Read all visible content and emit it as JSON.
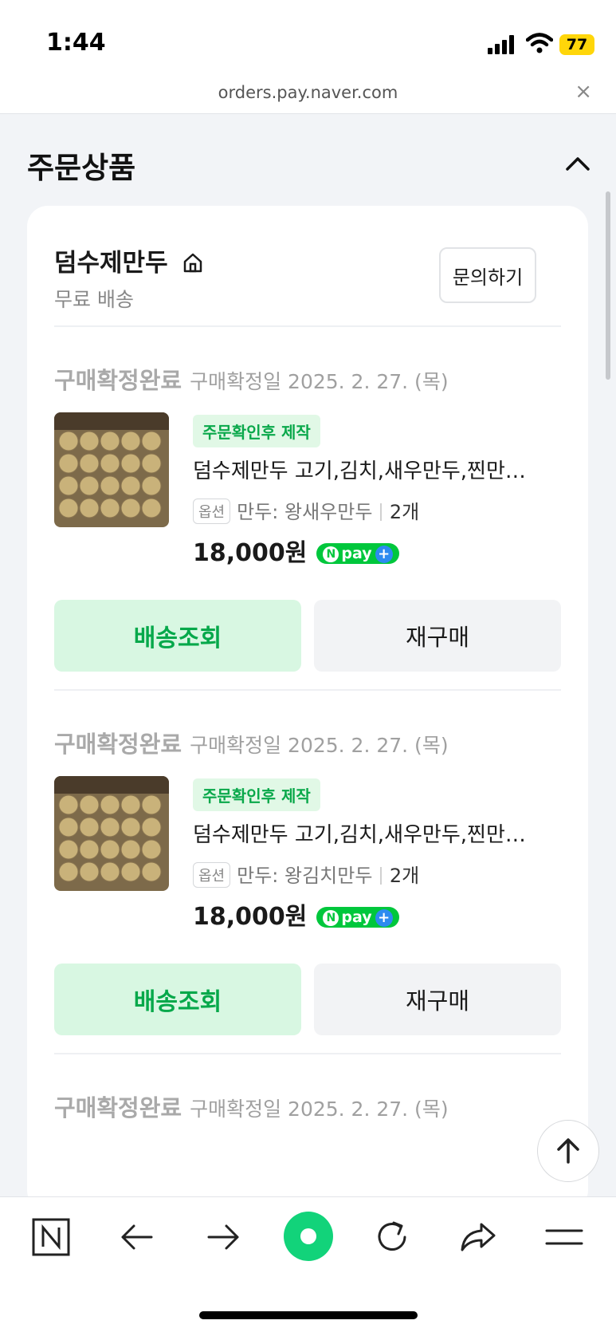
{
  "status_bar": {
    "time": "1:44",
    "battery": "77"
  },
  "browser": {
    "url": "orders.pay.naver.com",
    "close": "×"
  },
  "section": {
    "title": "주문상품"
  },
  "store": {
    "name": "덤수제만두",
    "shipping": "무료 배송",
    "inquiry_label": "문의하기"
  },
  "orders": [
    {
      "status": "구매확정완료",
      "date": "구매확정일 2025. 2. 27. (목)",
      "badge": "주문확인후 제작",
      "product_name": "덤수제만두 고기,김치,새우만두,찐만두,군만두",
      "option_tag": "옵션",
      "option_value": "만두: 왕새우만두",
      "quantity": "2개",
      "price": "18,000원",
      "npay": "pay",
      "track_label": "배송조회",
      "rebuy_label": "재구매"
    },
    {
      "status": "구매확정완료",
      "date": "구매확정일 2025. 2. 27. (목)",
      "badge": "주문확인후 제작",
      "product_name": "덤수제만두 고기,김치,새우만두,찐만두,군만두",
      "option_tag": "옵션",
      "option_value": "만두: 왕김치만두",
      "quantity": "2개",
      "price": "18,000원",
      "npay": "pay",
      "track_label": "배송조회",
      "rebuy_label": "재구매"
    },
    {
      "status": "구매확정완료",
      "date": "구매확정일 2025. 2. 27. (목)"
    }
  ],
  "colors": {
    "accent_green": "#00c73c",
    "track_bg": "#d8f7e2",
    "track_text": "#05a84a"
  },
  "icons": [
    "home-icon",
    "chevron-up-icon",
    "arrow-up-icon",
    "naver-n-icon",
    "back-arrow-icon",
    "forward-arrow-icon",
    "naver-green-dot-icon",
    "refresh-icon",
    "share-icon",
    "menu-icon"
  ]
}
